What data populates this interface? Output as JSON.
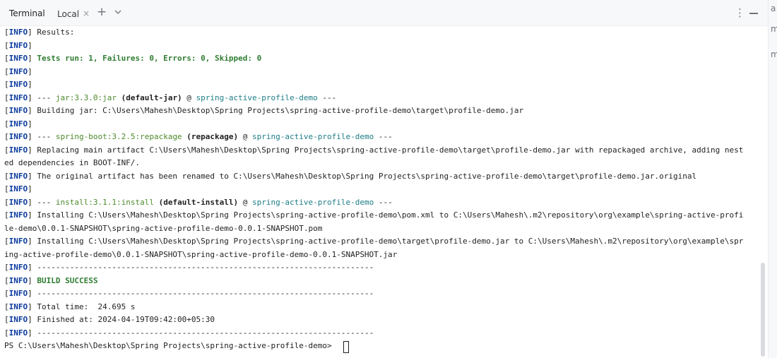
{
  "header": {
    "title": "Terminal",
    "tab_label": "Local",
    "close_symbol": "×",
    "new_tab_symbol": "+",
    "more_symbol": "⋮"
  },
  "right_strip": {
    "icons": [
      "a",
      "m",
      "m"
    ]
  },
  "console": {
    "info_open": "[",
    "info_word": "INFO",
    "info_close": "]",
    "lines": [
      {
        "text": " Results:"
      },
      {
        "text": ""
      },
      {
        "green": " Tests run: 1, Failures: 0, Errors: 0, Skipped: 0"
      },
      {
        "text": ""
      },
      {
        "text": ""
      },
      {
        "pre": " --- ",
        "plugin": "jar:3.3.0:jar",
        "exec": " (default-jar)",
        "at": " @ ",
        "project": "spring-active-profile-demo",
        "post": " ---"
      },
      {
        "text": " Building jar: C:\\Users\\Mahesh\\Desktop\\Spring Projects\\spring-active-profile-demo\\target\\profile-demo.jar"
      },
      {
        "text": ""
      },
      {
        "pre": " --- ",
        "plugin": "spring-boot:3.2.5:repackage",
        "exec": " (repackage)",
        "at": " @ ",
        "project": "spring-active-profile-demo",
        "post": " ---"
      },
      {
        "text": " Replacing main artifact C:\\Users\\Mahesh\\Desktop\\Spring Projects\\spring-active-profile-demo\\target\\profile-demo.jar with repackaged archive, adding nest"
      },
      {
        "cont": "ed dependencies in BOOT-INF/."
      },
      {
        "text": " The original artifact has been renamed to C:\\Users\\Mahesh\\Desktop\\Spring Projects\\spring-active-profile-demo\\target\\profile-demo.jar.original"
      },
      {
        "text": ""
      },
      {
        "pre": " --- ",
        "plugin": "install:3.1.1:install",
        "exec": " (default-install)",
        "at": " @ ",
        "project": "spring-active-profile-demo",
        "post": " ---"
      },
      {
        "text": " Installing C:\\Users\\Mahesh\\Desktop\\Spring Projects\\spring-active-profile-demo\\pom.xml to C:\\Users\\Mahesh\\.m2\\repository\\org\\example\\spring-active-profi"
      },
      {
        "cont": "le-demo\\0.0.1-SNAPSHOT\\spring-active-profile-demo-0.0.1-SNAPSHOT.pom"
      },
      {
        "text": " Installing C:\\Users\\Mahesh\\Desktop\\Spring Projects\\spring-active-profile-demo\\target\\profile-demo.jar to C:\\Users\\Mahesh\\.m2\\repository\\org\\example\\spr"
      },
      {
        "cont": "ing-active-profile-demo\\0.0.1-SNAPSHOT\\spring-active-profile-demo-0.0.1-SNAPSHOT.jar"
      },
      {
        "text": " ------------------------------------------------------------------------"
      },
      {
        "green": " BUILD SUCCESS"
      },
      {
        "text": " ------------------------------------------------------------------------"
      },
      {
        "text": " Total time:  24.695 s"
      },
      {
        "text": " Finished at: 2024-04-19T09:42:00+05:30"
      },
      {
        "text": " ------------------------------------------------------------------------"
      },
      {
        "cont": "PS C:\\Users\\Mahesh\\Desktop\\Spring Projects\\spring-active-profile-demo> "
      }
    ]
  }
}
